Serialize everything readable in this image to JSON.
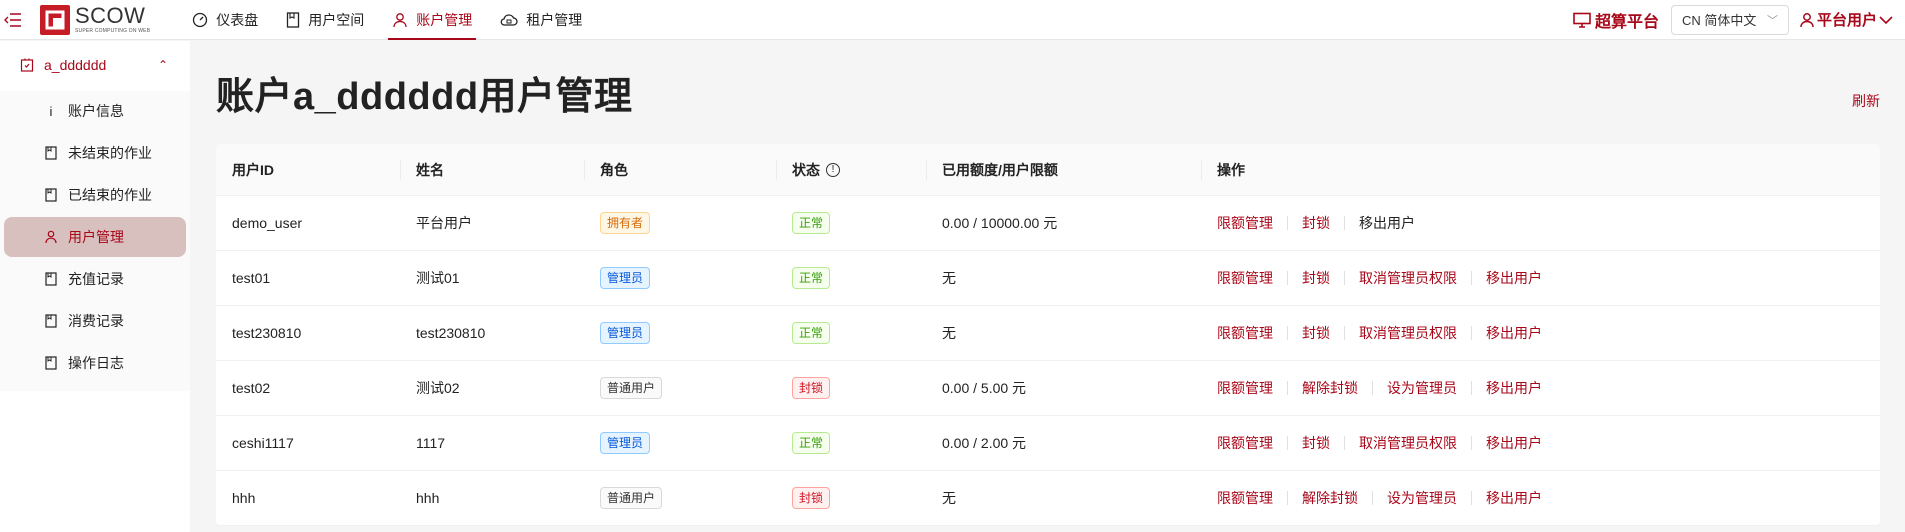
{
  "header": {
    "logo_mark": "▣",
    "logo_text": "SCOW",
    "logo_sub": "SUPER COMPUTING ON WEB",
    "nav": [
      {
        "label": "仪表盘",
        "icon": "dashboard-icon"
      },
      {
        "label": "用户空间",
        "icon": "document-icon"
      },
      {
        "label": "账户管理",
        "icon": "user-icon",
        "active": true
      },
      {
        "label": "租户管理",
        "icon": "cloud-icon"
      }
    ],
    "platform_title": "超算平台",
    "language": "CN 简体中文",
    "user_menu": "平台用户"
  },
  "sidebar": {
    "account": "a_dddddd",
    "items": [
      {
        "label": "账户信息",
        "icon": "info-icon"
      },
      {
        "label": "未结束的作业",
        "icon": "document-icon"
      },
      {
        "label": "已结束的作业",
        "icon": "document-icon"
      },
      {
        "label": "用户管理",
        "icon": "user-icon",
        "active": true
      },
      {
        "label": "充值记录",
        "icon": "document-icon"
      },
      {
        "label": "消费记录",
        "icon": "document-icon"
      },
      {
        "label": "操作日志",
        "icon": "document-icon"
      }
    ]
  },
  "main": {
    "title": "账户a_dddddd用户管理",
    "refresh": "刷新",
    "columns": [
      "用户ID",
      "姓名",
      "角色",
      "状态",
      "已用额度/用户限额",
      "操作"
    ],
    "rows": [
      {
        "id": "demo_user",
        "name": "平台用户",
        "role": "拥有者",
        "role_style": "orange",
        "status": "正常",
        "status_style": "green",
        "quota": "0.00 / 10000.00 元",
        "actions": [
          "限额管理",
          "封锁",
          "移出用户"
        ]
      },
      {
        "id": "test01",
        "name": "测试01",
        "role": "管理员",
        "role_style": "blue",
        "status": "正常",
        "status_style": "green",
        "quota": "无",
        "actions": [
          "限额管理",
          "封锁",
          "取消管理员权限",
          "移出用户"
        ]
      },
      {
        "id": "test230810",
        "name": "test230810",
        "role": "管理员",
        "role_style": "blue",
        "status": "正常",
        "status_style": "green",
        "quota": "无",
        "actions": [
          "限额管理",
          "封锁",
          "取消管理员权限",
          "移出用户"
        ]
      },
      {
        "id": "test02",
        "name": "测试02",
        "role": "普通用户",
        "role_style": "default",
        "status": "封锁",
        "status_style": "red",
        "quota": "0.00 / 5.00 元",
        "actions": [
          "限额管理",
          "解除封锁",
          "设为管理员",
          "移出用户"
        ]
      },
      {
        "id": "ceshi1117",
        "name": "1117",
        "role": "管理员",
        "role_style": "blue",
        "status": "正常",
        "status_style": "green",
        "quota": "0.00 / 2.00 元",
        "actions": [
          "限额管理",
          "封锁",
          "取消管理员权限",
          "移出用户"
        ]
      },
      {
        "id": "hhh",
        "name": "hhh",
        "role": "普通用户",
        "role_style": "default",
        "status": "封锁",
        "status_style": "red",
        "quota": "无",
        "actions": [
          "限额管理",
          "解除封锁",
          "设为管理员",
          "移出用户"
        ]
      }
    ]
  },
  "colors": {
    "accent": "#a8071a",
    "active_bg": "#d8c0bf"
  }
}
